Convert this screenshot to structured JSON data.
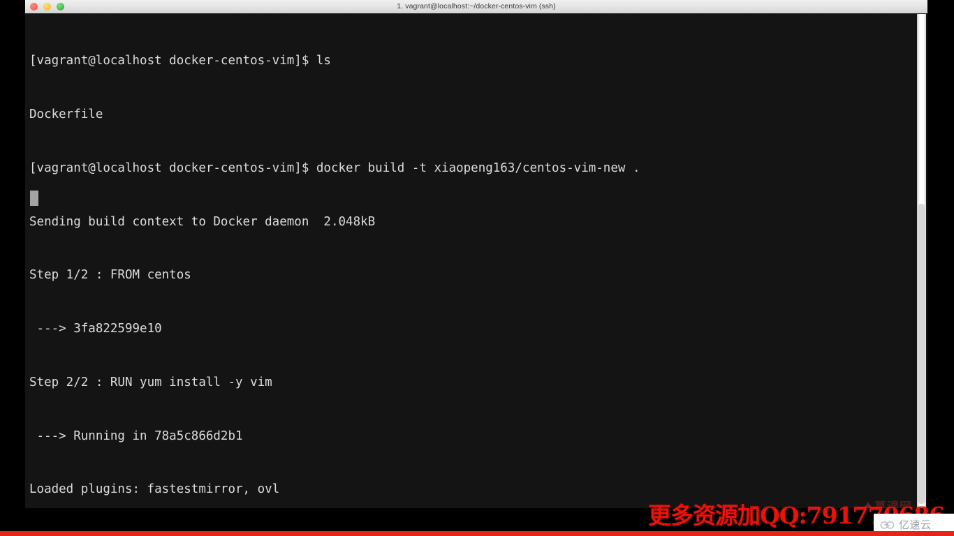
{
  "window": {
    "title": "1. vagrant@localhost:~/docker-centos-vim (ssh)",
    "traffic_lights": [
      {
        "name": "close",
        "color": "#f0553f"
      },
      {
        "name": "minimize",
        "color": "#f0b429"
      },
      {
        "name": "maximize",
        "color": "#28a828"
      }
    ]
  },
  "terminal": {
    "prompt": "[vagrant@localhost docker-centos-vim]$",
    "lines": [
      "[vagrant@localhost docker-centos-vim]$ ls",
      "Dockerfile",
      "[vagrant@localhost docker-centos-vim]$ docker build -t xiaopeng163/centos-vim-new .",
      "Sending build context to Docker daemon  2.048kB",
      "Step 1/2 : FROM centos",
      " ---> 3fa822599e10",
      "Step 2/2 : RUN yum install -y vim",
      " ---> Running in 78a5c866d2b1",
      "Loaded plugins: fastestmirror, ovl"
    ],
    "cursor": "block",
    "text_color": "#dcdcdc",
    "background_color": "#141414"
  },
  "watermarks": {
    "imooc": {
      "label": "慕课网",
      "icon": "flame-icon",
      "color": "#7b2c24"
    },
    "qq_promo": {
      "text": "更多资源加QQ:791770686",
      "color": "#e8140c"
    },
    "yisuyun": {
      "label": "亿速云",
      "icon": "cloud-icon",
      "color": "#9aa0a6",
      "background": "#ffffff"
    }
  },
  "decorations": {
    "bottom_bar_color": "#e8241a"
  }
}
